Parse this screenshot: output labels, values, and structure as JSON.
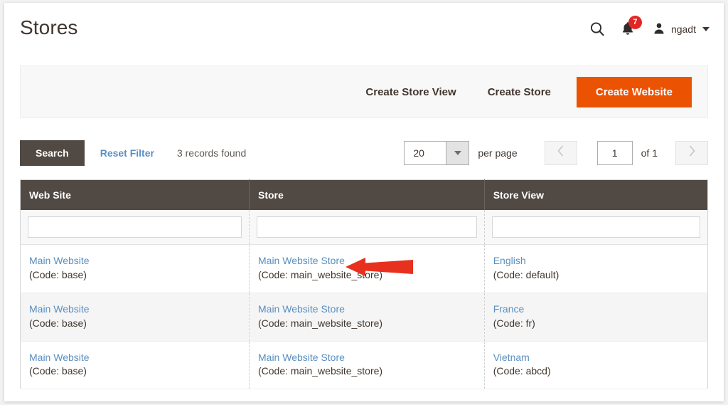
{
  "header": {
    "title": "Stores",
    "search_icon": "search-icon",
    "notifications": {
      "icon": "bell-icon",
      "count": "7"
    },
    "account": {
      "avatar_icon": "user-avatar-icon",
      "name": "ngadt",
      "caret_icon": "chevron-down-icon"
    }
  },
  "actions": {
    "create_store_view": "Create Store View",
    "create_store": "Create Store",
    "create_website": "Create Website"
  },
  "toolbar": {
    "search_label": "Search",
    "reset_filter_label": "Reset Filter",
    "records_found": "3 records found",
    "per_page_value": "20",
    "per_page_label": "per page",
    "prev_icon": "chevron-left-icon",
    "next_icon": "chevron-right-icon",
    "page_value": "1",
    "of_label": "of 1"
  },
  "grid": {
    "columns": [
      {
        "label": "Web Site",
        "filter_value": ""
      },
      {
        "label": "Store",
        "filter_value": ""
      },
      {
        "label": "Store View",
        "filter_value": ""
      }
    ],
    "rows": [
      {
        "website_name": "Main Website",
        "website_code": "(Code: base)",
        "store_name": "Main Website Store",
        "store_code": "(Code: main_website_store)",
        "store_view_name": "English",
        "store_view_code": "(Code: default)"
      },
      {
        "website_name": "Main Website",
        "website_code": "(Code: base)",
        "store_name": "Main Website Store",
        "store_code": "(Code: main_website_store)",
        "store_view_name": "France",
        "store_view_code": "(Code: fr)"
      },
      {
        "website_name": "Main Website",
        "website_code": "(Code: base)",
        "store_name": "Main Website Store",
        "store_code": "(Code: main_website_store)",
        "store_view_name": "Vietnam",
        "store_view_code": "(Code: abcd)"
      }
    ]
  },
  "annotation": {
    "arrow_icon": "red-left-arrow-annotation",
    "color": "#e8301f"
  },
  "colors": {
    "accent_orange": "#eb5202",
    "dark_brown": "#514943",
    "link_blue": "#5a8fc0",
    "badge_red": "#e22626",
    "page_bg": "#f2f2f2"
  }
}
